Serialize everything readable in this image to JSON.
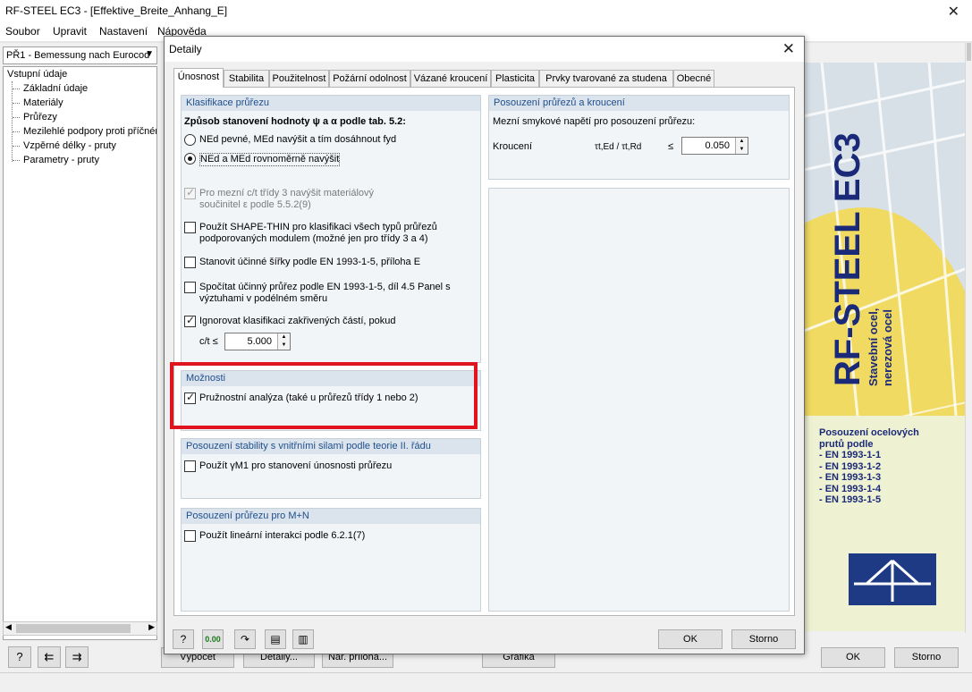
{
  "main_window": {
    "title": "RF-STEEL EC3 - [Effektive_Breite_Anhang_E]",
    "menu": [
      "Soubor",
      "Upravit",
      "Nastavení",
      "Nápověda"
    ],
    "case_select": "PŘ1 - Bemessung nach Eurocod",
    "tree": {
      "root": "Vstupní údaje",
      "children": [
        "Základní údaje",
        "Materiály",
        "Průřezy",
        "Mezilehlé podpory proti příčném",
        "Vzpěrné délky - pruty",
        "Parametry - pruty"
      ]
    },
    "bottom_buttons": {
      "calc": "Výpočet",
      "details": "Detaily...",
      "annex": "Nár. příloha...",
      "graphics": "Grafika",
      "ok": "OK",
      "cancel": "Storno"
    },
    "banner": {
      "title": "RF-STEEL EC3",
      "subtitle1": "Stavební ocel,",
      "subtitle2": "nerezová ocel",
      "desc1": "Posouzení ocelových",
      "desc2": "prutů podle",
      "norms": [
        "- EN 1993-1-1",
        "- EN 1993-1-2",
        "- EN 1993-1-3",
        "- EN 1993-1-4",
        "- EN 1993-1-5"
      ]
    }
  },
  "dialog": {
    "title": "Detaily",
    "tabs": [
      "Únosnost",
      "Stabilita",
      "Použitelnost",
      "Požární odolnost",
      "Vázané kroucení",
      "Plasticita",
      "Prvky tvarované za studena",
      "Obecné"
    ],
    "active_tab": "Únosnost",
    "classification": {
      "header": "Klasifikace průřezu",
      "method_label": "Způsob stanovení hodnoty ψ a α podle tab. 5.2:",
      "radio1": "NEd pevné, MEd navýšit a tím dosáhnout fyd",
      "radio2": "NEd a MEd rovnoměrně navýšit",
      "selected_radio": 2,
      "opt_class3_line1": "Pro mezní c/t třídy 3 navýšit materiálový",
      "opt_class3_line2": "součinitel ε podle 5.5.2(9)",
      "opt_shapethin_line1": "Použít SHAPE-THIN pro klasifikaci všech typů průřezů",
      "opt_shapethin_line2": "podporovaných modulem (možné jen pro třídy 3 a 4)",
      "opt_eff_width": "Stanovit účinné šířky podle EN 1993-1-5, příloha E",
      "opt_eff_section_line1": "Spočítat účinný průřez podle EN 1993-1-5, díl 4.5 Panel s",
      "opt_eff_section_line2": "výztuhami v podélném směru",
      "opt_ignore": "Ignorovat klasifikaci zakřivených částí, pokud",
      "ct_label": "c/t ≤",
      "ct_value": "5.000"
    },
    "options": {
      "header": "Možnosti",
      "elastic": "Pružnostní analýza (také u průřezů třídy 1 nebo 2)"
    },
    "stability_second_order": {
      "header": "Posouzení stability s vnitřními silami podle teorie II. řádu",
      "use_gamma": "Použít γM1 pro stanovení únosnosti průřezu"
    },
    "mn": {
      "header": "Posouzení průřezu pro M+N",
      "linear": "Použít lineární interakci podle 6.2.1(7)"
    },
    "torsion": {
      "header": "Posouzení průřezů a kroucení",
      "limit_label": "Mezní smykové napětí pro posouzení průřezu:",
      "row_label": "Kroucení",
      "formula": "τt,Ed / τt,Rd",
      "le": "≤",
      "value": "0.050"
    },
    "buttons": {
      "ok": "OK",
      "cancel": "Storno"
    },
    "highlight_color": "#e0141e"
  }
}
